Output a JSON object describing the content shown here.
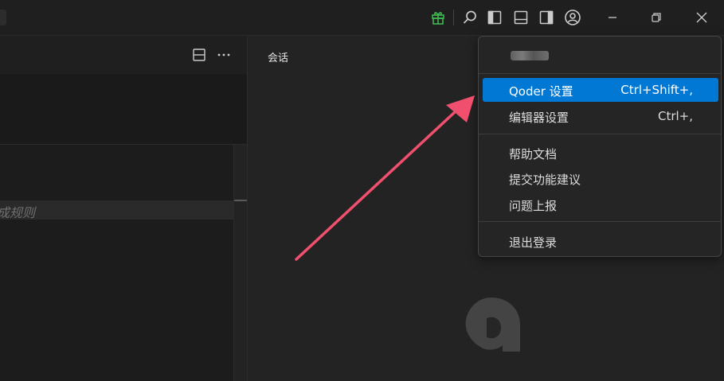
{
  "titlebar": {
    "icons": [
      "gift-icon",
      "search-icon",
      "toggle-primary-sidebar-icon",
      "toggle-panel-icon",
      "toggle-secondary-sidebar-icon",
      "account-icon",
      "minimize-icon",
      "restore-icon",
      "close-icon"
    ],
    "gift_color": "#3fb950"
  },
  "left_panel": {
    "icons": [
      "split-editor-icon",
      "more-actions-icon"
    ],
    "rules_text": "成规则"
  },
  "right_panel": {
    "title": "会话"
  },
  "account_menu": {
    "items": [
      {
        "label": "Qoder 设置",
        "shortcut": "Ctrl+Shift+,",
        "active": true
      },
      {
        "label": "编辑器设置",
        "shortcut": "Ctrl+,",
        "active": false
      },
      {
        "label": "帮助文档",
        "shortcut": "",
        "active": false
      },
      {
        "label": "提交功能建议",
        "shortcut": "",
        "active": false
      },
      {
        "label": "问题上报",
        "shortcut": "",
        "active": false
      },
      {
        "label": "退出登录",
        "shortcut": "",
        "active": false
      }
    ],
    "highlight_color": "#0078d4"
  },
  "annotation": {
    "arrow_color": "#f0506e"
  }
}
